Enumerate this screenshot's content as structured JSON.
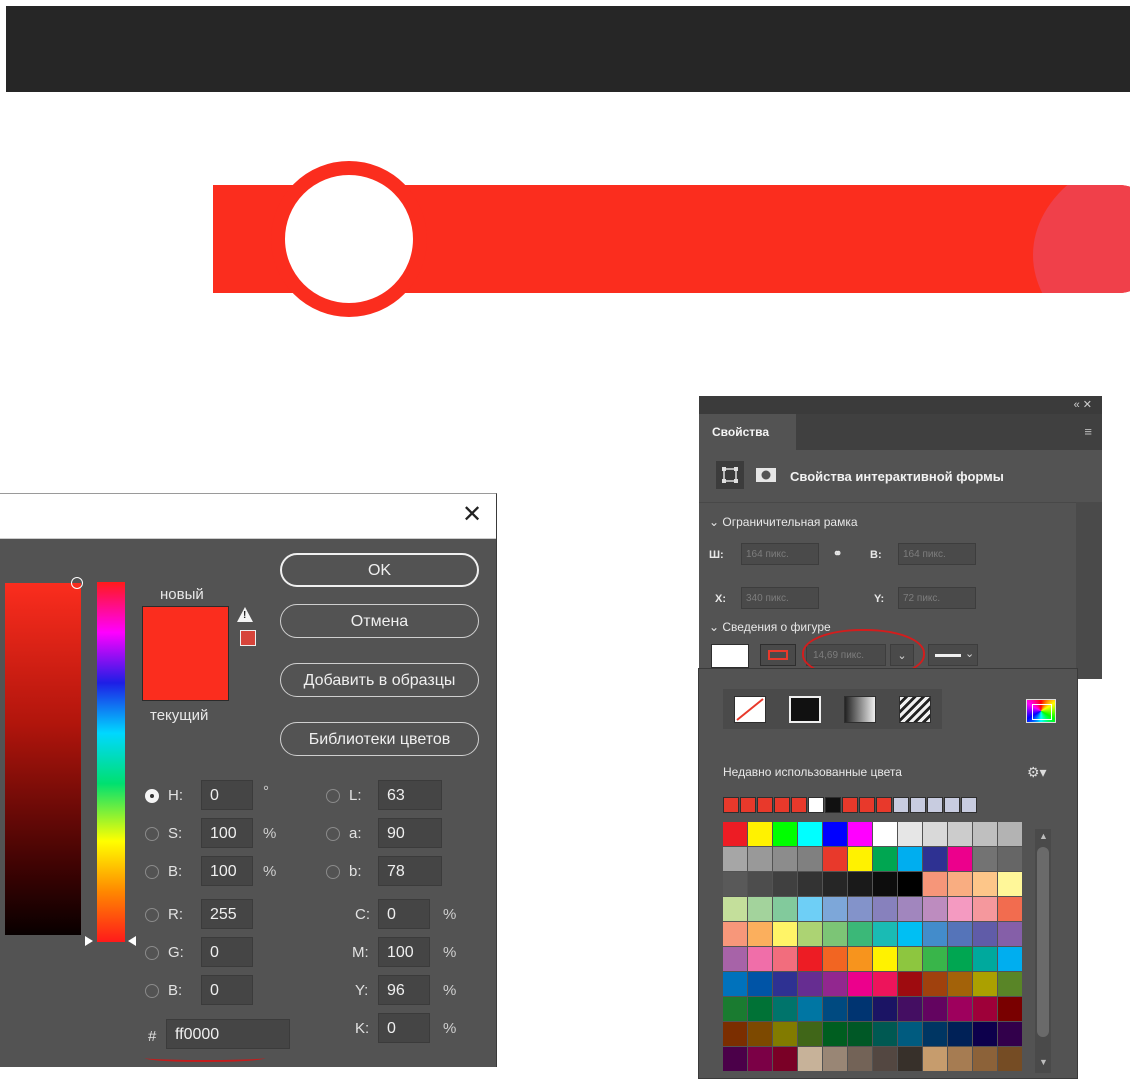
{
  "picker": {
    "label_new": "новый",
    "label_current": "текущий",
    "new_color": "#fb2d1e",
    "current_color": "#fb2d1e",
    "buttons": {
      "ok": "OK",
      "cancel": "Отмена",
      "add_to_swatches": "Добавить в образцы",
      "color_libraries": "Библиотеки цветов"
    },
    "fields": {
      "h": {
        "label": "H:",
        "value": "0",
        "unit": "°",
        "selected": true
      },
      "s": {
        "label": "S:",
        "value": "100",
        "unit": "%"
      },
      "b": {
        "label": "B:",
        "value": "100",
        "unit": "%"
      },
      "r": {
        "label": "R:",
        "value": "255"
      },
      "g": {
        "label": "G:",
        "value": "0"
      },
      "b2": {
        "label": "B:",
        "value": "0"
      },
      "l": {
        "label": "L:",
        "value": "63"
      },
      "a": {
        "label": "a:",
        "value": "90"
      },
      "lab_b": {
        "label": "b:",
        "value": "78"
      },
      "c": {
        "label": "C:",
        "value": "0",
        "unit": "%"
      },
      "m": {
        "label": "M:",
        "value": "100",
        "unit": "%"
      },
      "y": {
        "label": "Y:",
        "value": "96",
        "unit": "%"
      },
      "k": {
        "label": "K:",
        "value": "0",
        "unit": "%"
      },
      "hex": {
        "label": "#",
        "value": "ff0000"
      }
    }
  },
  "properties": {
    "tab": "Свойства",
    "header": "Свойства интерактивной формы",
    "section_bounds": "Ограничительная рамка",
    "section_shape": "Сведения о фигуре",
    "w_label": "Ш:",
    "w_value": "164 пикс.",
    "h_label": "В:",
    "h_value": "164 пикс.",
    "x_label": "X:",
    "x_value": "340 пикс.",
    "y_label": "Y:",
    "y_value": "72 пикс.",
    "stroke_width": "14,69 пикс.",
    "strip_icons": "«  ✕"
  },
  "swatch_popover": {
    "recent_label": "Недавно использованные цвета",
    "recent_colors": [
      "#e8392b",
      "#e8392b",
      "#e8392b",
      "#e8392b",
      "#e8392b",
      "#ffffff",
      "#111111",
      "#e8392b",
      "#e8392b",
      "#e8392b",
      "#c8cce0",
      "#c8cce0",
      "#c8cce0",
      "#c8cce0",
      "#c8cce0"
    ],
    "grid_colors": [
      "#ed1c24",
      "#fff200",
      "#00ff00",
      "#00ffff",
      "#0000ff",
      "#ff00ff",
      "#ffffff",
      "#e6e6e6",
      "#d9d9d9",
      "#cccccc",
      "#bfbfbf",
      "#b3b3b3",
      "#a6a6a6",
      "#999999",
      "#8c8c8c",
      "#808080",
      "#e8392b",
      "#fff200",
      "#00a651",
      "#00aeef",
      "#2e3192",
      "#ec008c",
      "#737373",
      "#666666",
      "#595959",
      "#4d4d4d",
      "#404040",
      "#333333",
      "#262626",
      "#1a1a1a",
      "#0d0d0d",
      "#000000",
      "#f69679",
      "#f9ad81",
      "#fdc689",
      "#fff799",
      "#c4df9b",
      "#a3d39c",
      "#82ca9c",
      "#6ecff6",
      "#7da7d9",
      "#8393ca",
      "#8781bd",
      "#a186be",
      "#bd8cbf",
      "#f49ac1",
      "#f5989d",
      "#f26c4f",
      "#f7977a",
      "#fbaf5d",
      "#fff467",
      "#acd373",
      "#7cc576",
      "#3bb878",
      "#1abbb4",
      "#00bff3",
      "#438ccb",
      "#5574b9",
      "#605ca8",
      "#855fa8",
      "#a763a8",
      "#f06ea9",
      "#f26d7d",
      "#ed1c24",
      "#f26522",
      "#f7941d",
      "#fff200",
      "#8dc63f",
      "#39b54a",
      "#00a651",
      "#00a99d",
      "#00aeef",
      "#0072bc",
      "#0054a6",
      "#2e3192",
      "#662d91",
      "#92278f",
      "#ec008c",
      "#ed145b",
      "#9e0b0f",
      "#a0410d",
      "#a36209",
      "#aba000",
      "#598527",
      "#1a7b30",
      "#007236",
      "#00746b",
      "#0076a3",
      "#004a80",
      "#003471",
      "#1b1464",
      "#440e62",
      "#630460",
      "#9e005d",
      "#9e0039",
      "#790000",
      "#7b2e00",
      "#7d4900",
      "#827b00",
      "#406618",
      "#005e20",
      "#005826",
      "#005952",
      "#005b7f",
      "#003663",
      "#002157",
      "#0d004c",
      "#32004b",
      "#4b0049",
      "#7b0046",
      "#7a0026",
      "#c7b299",
      "#998675",
      "#736357",
      "#534741",
      "#37302a",
      "#c69c6d",
      "#a67c52",
      "#8c6239",
      "#754c24"
    ]
  }
}
